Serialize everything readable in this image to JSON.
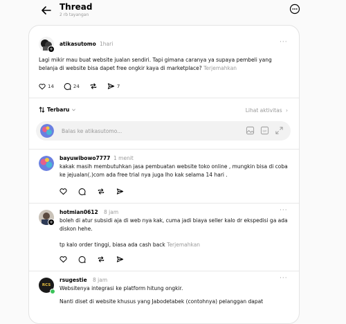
{
  "header": {
    "title": "Thread",
    "views": "2 rb tayangan"
  },
  "post": {
    "username": "atikasutomo",
    "time": "1hari",
    "text": "Lagi mikir mau buat website jualan sendiri. Tapi gimana caranya ya supaya pembeli yang belanja di website bisa dapet free ongkir kaya di marketplace?",
    "translate": "Terjemahkan",
    "likes": "14",
    "comments": "24",
    "shares": "7"
  },
  "sort": {
    "label": "Terbaru",
    "activity": "Lihat aktivitas"
  },
  "reply": {
    "placeholder": "Balas ke atikasutomo..."
  },
  "replies": [
    {
      "username": "bayuwibowo7777",
      "time": "1 menit",
      "text": "kakak masih membutuhkan jasa pembuatan website toko online , mungkin bisa di coba ke jejualan(.)com ada free trial nya juga lho kak selama 14 hari ."
    },
    {
      "username": "hotmian0612",
      "time": "8 jam",
      "text": "boleh di atur subsidi aja di web nya kak, cuma jadi biaya seller kalo dr ekspedisi ga ada diskon hehe.",
      "text2": "tp kalo order tinggi, biasa ada cash back",
      "translate": "Terjemahkan"
    },
    {
      "username": "rsugestie",
      "time": "8 jam",
      "text": "Websitenya integrasi ke platform hitung ongkir.",
      "text2": "Nanti diset di website khusus yang Jabodetabek (contohnya) pelanggan dapat",
      "avatar_text": "RCS"
    }
  ]
}
